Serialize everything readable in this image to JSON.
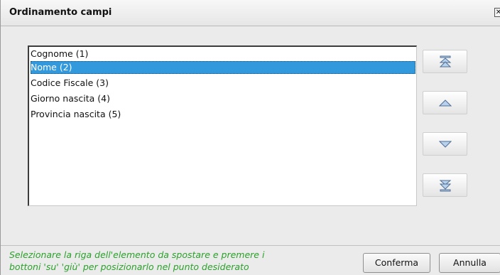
{
  "dialog": {
    "title": "Ordinamento campi",
    "close_label": "✕"
  },
  "list": {
    "items": [
      {
        "label": "Cognome (1)",
        "selected": false
      },
      {
        "label": "Nome (2)",
        "selected": true
      },
      {
        "label": "Codice Fiscale (3)",
        "selected": false
      },
      {
        "label": "Giorno nascita (4)",
        "selected": false
      },
      {
        "label": "Provincia nascita (5)",
        "selected": false
      }
    ]
  },
  "move_buttons": [
    {
      "name": "move-top-button",
      "icon": "move-top-icon"
    },
    {
      "name": "move-up-button",
      "icon": "move-up-icon"
    },
    {
      "name": "move-down-button",
      "icon": "move-down-icon"
    },
    {
      "name": "move-bottom-button",
      "icon": "move-bottom-icon"
    }
  ],
  "footer": {
    "hint_line1": "Selezionare la riga dell'elemento da spostare e premere i",
    "hint_line2": "bottoni 'su' 'giù' per posizionarlo nel punto desiderato",
    "confirm_label": "Conferma",
    "cancel_label": "Annulla"
  },
  "colors": {
    "selection": "#3399dd",
    "hint_text": "#2aa12a",
    "arrow_fill": "#b8d2ee",
    "arrow_stroke": "#4f6f93"
  }
}
